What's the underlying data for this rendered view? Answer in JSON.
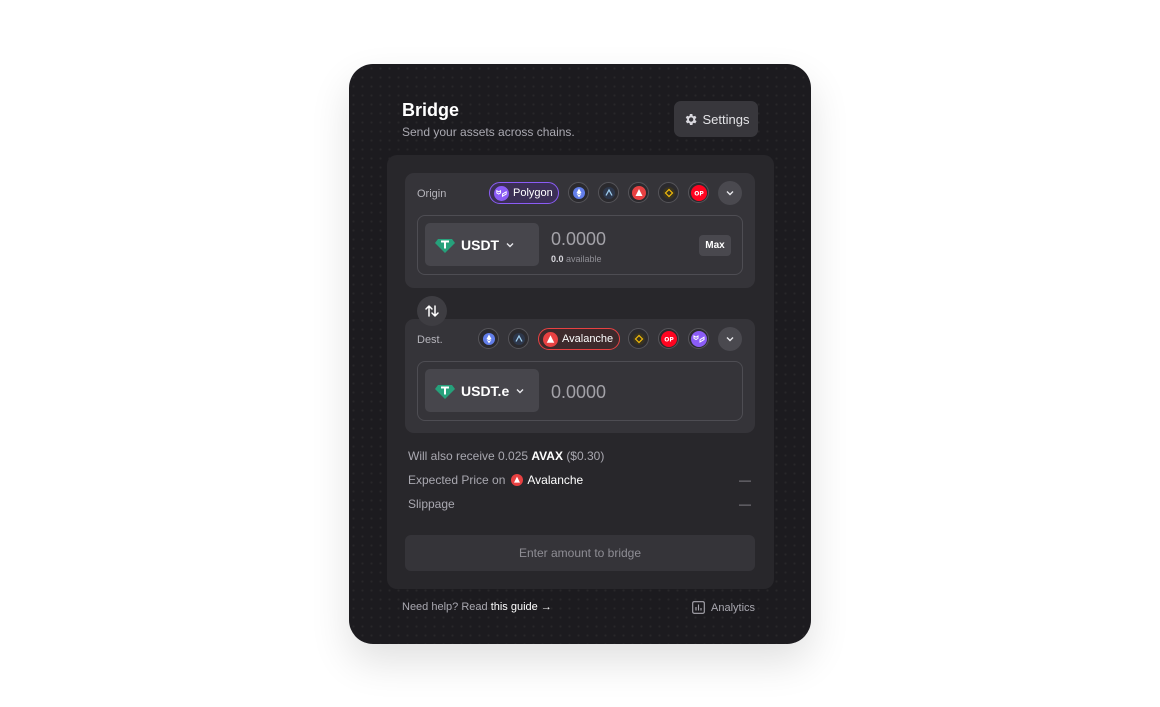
{
  "header": {
    "title": "Bridge",
    "subtitle": "Send your assets across chains.",
    "settings_label": "Settings"
  },
  "origin": {
    "label": "Origin",
    "selected_chain": "Polygon",
    "chains": [
      "ethereum-icon",
      "arbitrum-icon",
      "avalanche-icon",
      "bnb-icon",
      "optimism-icon"
    ],
    "token": "USDT",
    "amount": "0.0000",
    "available_value": "0.0",
    "available_label": "available",
    "max_label": "Max"
  },
  "destination": {
    "label": "Dest.",
    "selected_chain": "Avalanche",
    "chains": [
      "ethereum-icon",
      "arbitrum-icon",
      "bnb-icon",
      "optimism-icon",
      "polygon-icon"
    ],
    "token": "USDT.e",
    "amount": "0.0000"
  },
  "info": {
    "receive_prefix": "Will also receive 0.025",
    "receive_token": "AVAX",
    "receive_usd": "($0.30)",
    "expected_price_label": "Expected Price on",
    "expected_price_chain": "Avalanche",
    "expected_price_value": "—",
    "slippage_label": "Slippage",
    "slippage_value": "—"
  },
  "action": {
    "bridge_label": "Enter amount to bridge"
  },
  "footer": {
    "help_text": "Need help? Read",
    "help_link": "this guide →",
    "analytics_label": "Analytics"
  },
  "colors": {
    "card_bg": "#1c1b1f",
    "panel_bg": "#28272b",
    "polygon": "#8b5cf6",
    "avalanche": "#e84142",
    "tether": "#26a17b",
    "optimism": "#ff0420",
    "bnb": "#f0b90b"
  }
}
